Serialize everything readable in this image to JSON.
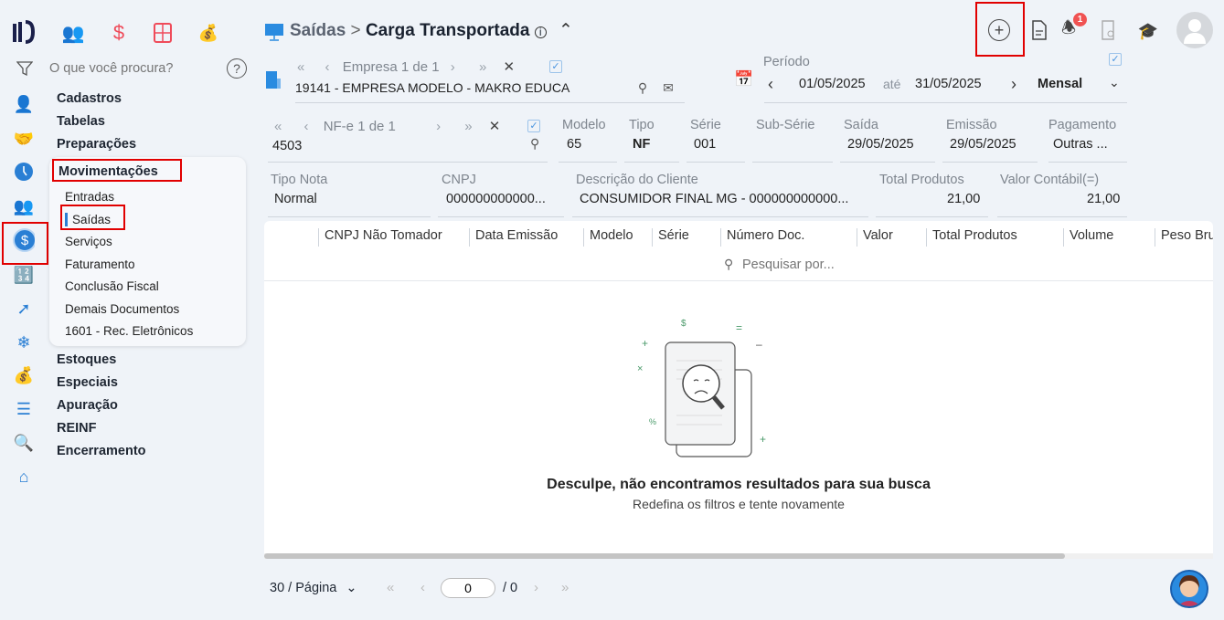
{
  "top_apps": [
    {
      "icon": "users-icon"
    },
    {
      "icon": "dollar-icon"
    },
    {
      "icon": "calculator-icon"
    },
    {
      "icon": "money-bag-icon"
    }
  ],
  "search": {
    "placeholder": "O que você procura?"
  },
  "menu": {
    "items": [
      "Cadastros",
      "Tabelas",
      "Preparações",
      "Movimentações",
      "Estoques",
      "Especiais",
      "Apuração",
      "REINF",
      "Encerramento"
    ],
    "sub_items": [
      "Entradas",
      "Saídas",
      "Serviços",
      "Faturamento",
      "Conclusão Fiscal",
      "Demais Documentos",
      "1601 - Rec. Eletrônicos"
    ]
  },
  "header": {
    "breadcrumb_parent": "Saídas",
    "separator": ">",
    "title": "Carga Transportada",
    "notification_count": "1"
  },
  "empresa": {
    "nav_label": "Empresa 1 de 1",
    "value": "19141 - EMPRESA MODELO - MAKRO EDUCA"
  },
  "periodo": {
    "label": "Período",
    "from": "01/05/2025",
    "ate": "até",
    "to": "31/05/2025",
    "mode": "Mensal"
  },
  "nfe": {
    "nav_label": "NF-e 1 de 1",
    "value": "4503"
  },
  "fields": [
    {
      "label": "Modelo",
      "value": "65"
    },
    {
      "label": "Tipo",
      "value": "NF"
    },
    {
      "label": "Série",
      "value": "001"
    },
    {
      "label": "Sub-Série",
      "value": ""
    },
    {
      "label": "Saída",
      "value": "29/05/2025"
    },
    {
      "label": "Emissão",
      "value": "29/05/2025"
    },
    {
      "label": "Pagamento",
      "value": "Outras ..."
    }
  ],
  "fields2": [
    {
      "label": "Tipo Nota",
      "value": "Normal"
    },
    {
      "label": "CNPJ",
      "value": "000000000000..."
    },
    {
      "label": "Descrição do Cliente",
      "value": "CONSUMIDOR FINAL MG - 000000000000..."
    },
    {
      "label": "Total Produtos",
      "value": "21,00"
    },
    {
      "label": "Valor Contábil(=)",
      "value": "21,00"
    }
  ],
  "table": {
    "columns": [
      "CNPJ Não Tomador",
      "Data Emissão",
      "Modelo",
      "Série",
      "Número Doc.",
      "Valor",
      "Total Produtos",
      "Volume",
      "Peso Bru"
    ],
    "search_placeholder": "Pesquisar por...",
    "empty_title": "Desculpe, não encontramos resultados para sua busca",
    "empty_subtitle": "Redefina os filtros e tente novamente"
  },
  "pagination": {
    "per_page": "30 / Página",
    "page": "0",
    "total": "/ 0"
  }
}
